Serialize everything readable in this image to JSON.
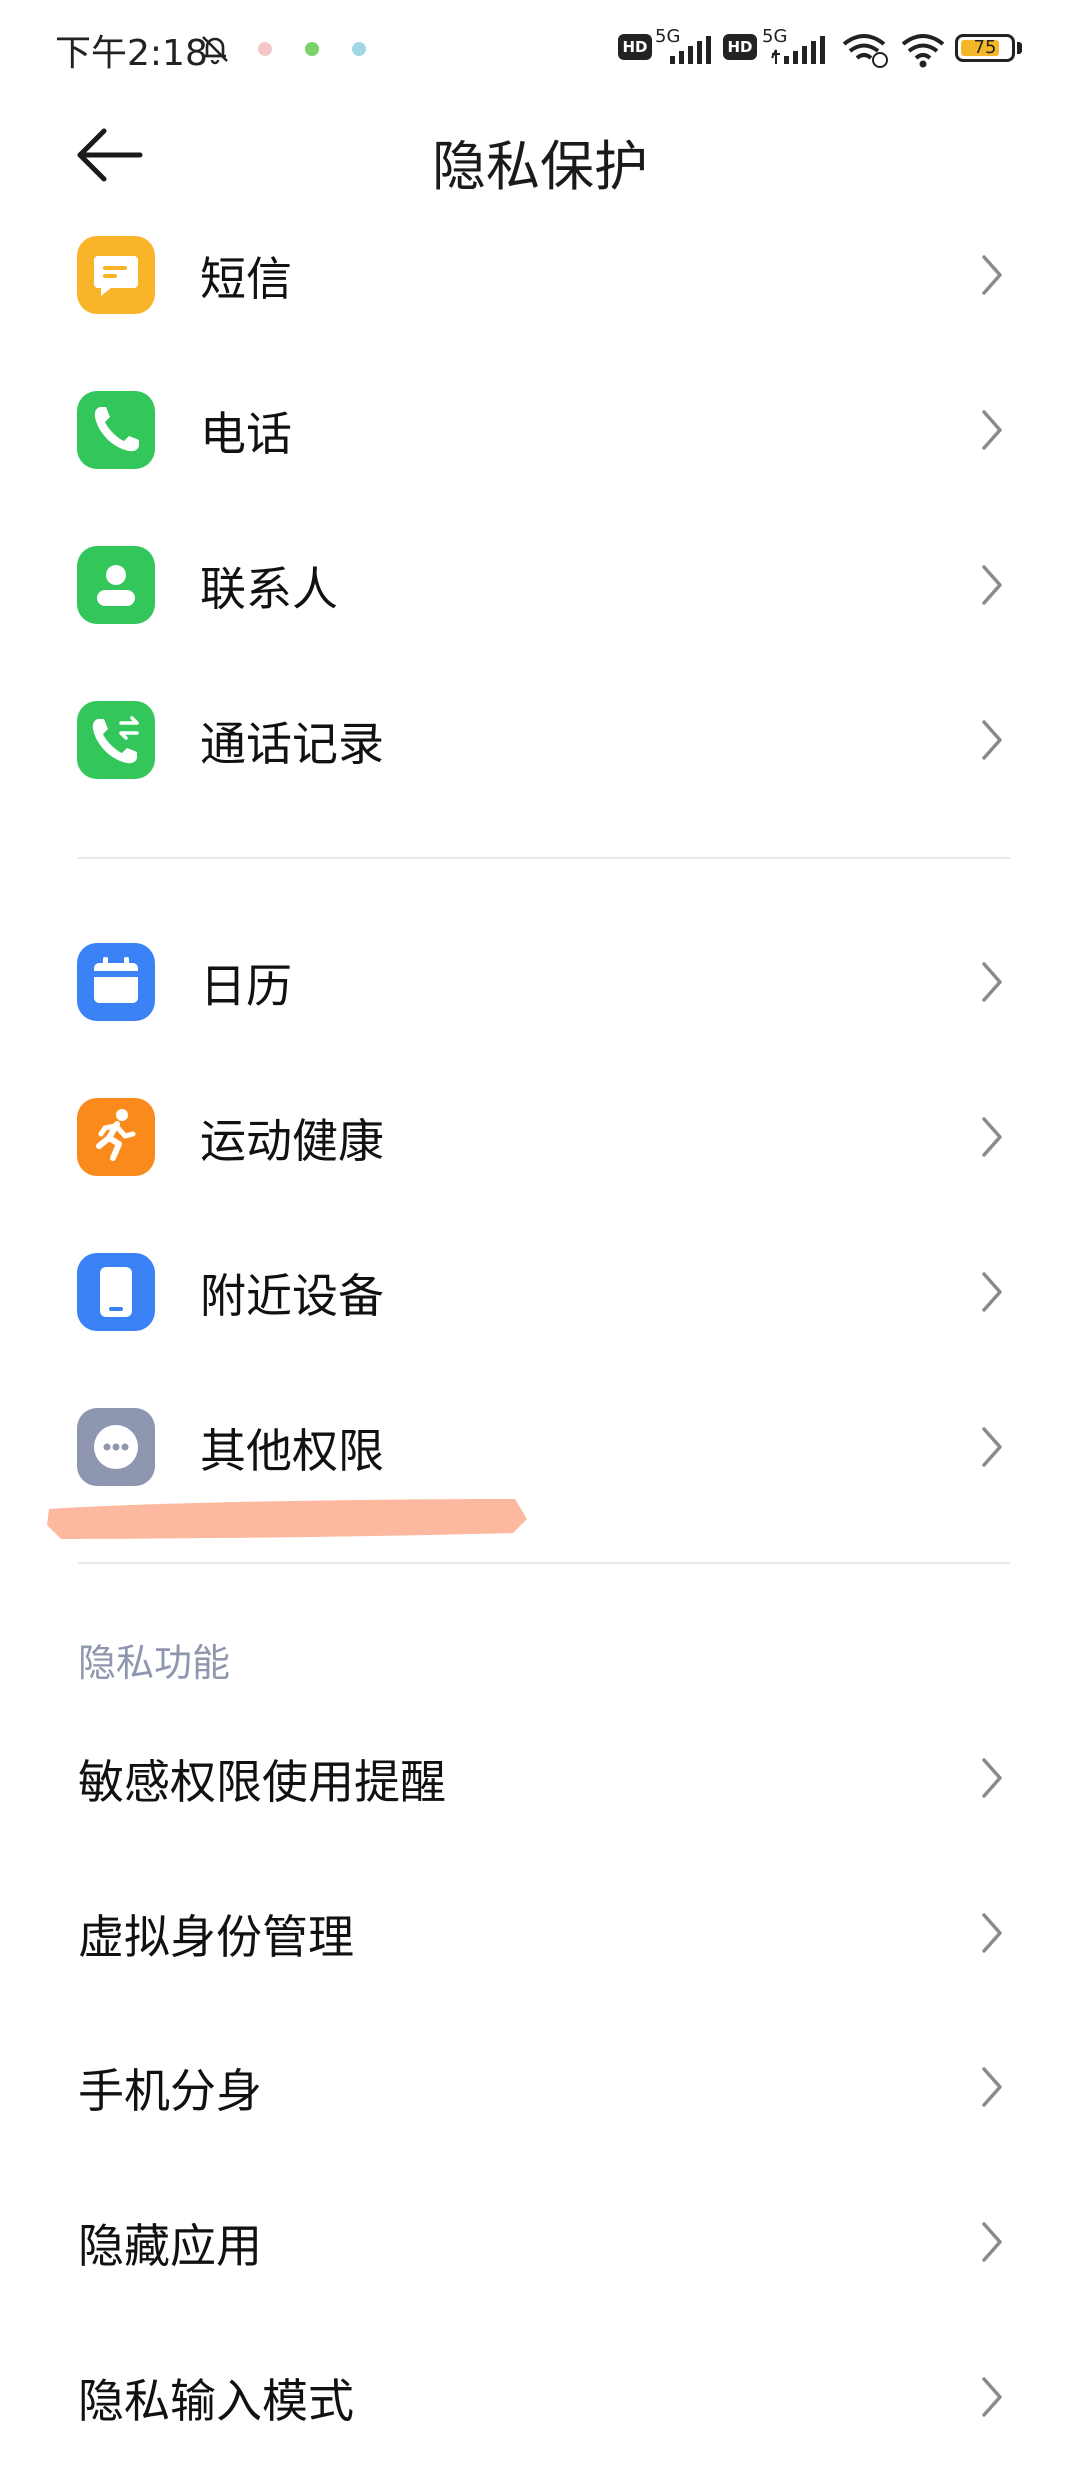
{
  "status_bar": {
    "time": "下午2:18",
    "network_1": "5G",
    "network_2": "5G",
    "hd_label": "HD",
    "battery": "75"
  },
  "header": {
    "title": "隐私保护"
  },
  "permissions_group_1": [
    {
      "label": "短信",
      "icon": "message-icon",
      "color": "#F9B429"
    },
    {
      "label": "电话",
      "icon": "phone-icon",
      "color": "#33C65A"
    },
    {
      "label": "联系人",
      "icon": "contact-icon",
      "color": "#33C65A"
    },
    {
      "label": "通话记录",
      "icon": "call-log-icon",
      "color": "#33C65A"
    }
  ],
  "permissions_group_2": [
    {
      "label": "日历",
      "icon": "calendar-icon",
      "color": "#3B82F6"
    },
    {
      "label": "运动健康",
      "icon": "running-icon",
      "color": "#FB8A1D"
    },
    {
      "label": "附近设备",
      "icon": "device-icon",
      "color": "#3B82F6"
    },
    {
      "label": "其他权限",
      "icon": "more-icon",
      "color": "#8F96B0"
    }
  ],
  "privacy_features": {
    "section_title": "隐私功能",
    "items": [
      {
        "label": "敏感权限使用提醒"
      },
      {
        "label": "虚拟身份管理"
      },
      {
        "label": "手机分身"
      },
      {
        "label": "隐藏应用"
      },
      {
        "label": "隐私输入模式"
      }
    ]
  },
  "colors": {
    "highlight_stroke": "#FDB8A0",
    "section_header": "#8E97AD"
  }
}
